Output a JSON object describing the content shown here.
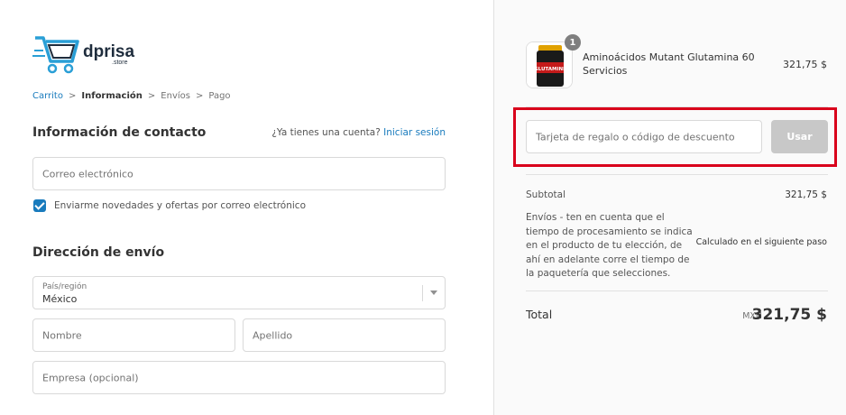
{
  "brand": {
    "name": "dprisa",
    "sub": ".store"
  },
  "breadcrumb": {
    "items": [
      {
        "label": "Carrito",
        "state": "link"
      },
      {
        "label": "Información",
        "state": "current"
      },
      {
        "label": "Envíos",
        "state": "upcoming"
      },
      {
        "label": "Pago",
        "state": "upcoming"
      }
    ],
    "separator": ">"
  },
  "contact": {
    "title": "Información de contacto",
    "account_prompt": "¿Ya tienes una cuenta?",
    "login_link": "Iniciar sesión",
    "email_placeholder": "Correo electrónico",
    "newsletter_label": "Enviarme novedades y ofertas por correo electrónico",
    "newsletter_checked": true
  },
  "shipping": {
    "title": "Dirección de envío",
    "country_label": "País/región",
    "country_value": "México",
    "first_name_placeholder": "Nombre",
    "last_name_placeholder": "Apellido",
    "company_placeholder": "Empresa (opcional)"
  },
  "summary": {
    "product": {
      "name": "Aminoácidos Mutant Glutamina 60 Servicios",
      "price": "321,75 $",
      "quantity": "1",
      "image_label": "GLUTAMINE"
    },
    "discount": {
      "placeholder": "Tarjeta de regalo o código de descuento",
      "button": "Usar"
    },
    "subtotal_label": "Subtotal",
    "subtotal_value": "321,75 $",
    "shipping_label": "Envíos - ten en cuenta que el tiempo de procesamiento se indica en el producto de tu elección, de ahí en adelante corre el tiempo de la paquetería que selecciones.",
    "shipping_value": "Calculado en el siguiente paso",
    "total_label": "Total",
    "currency": "MXN",
    "total_value": "321,75 $"
  },
  "colors": {
    "accent": "#197bbd",
    "highlight": "#d9001b",
    "button_disabled": "#c8c8c8",
    "sidebar_bg": "#fafafa"
  }
}
